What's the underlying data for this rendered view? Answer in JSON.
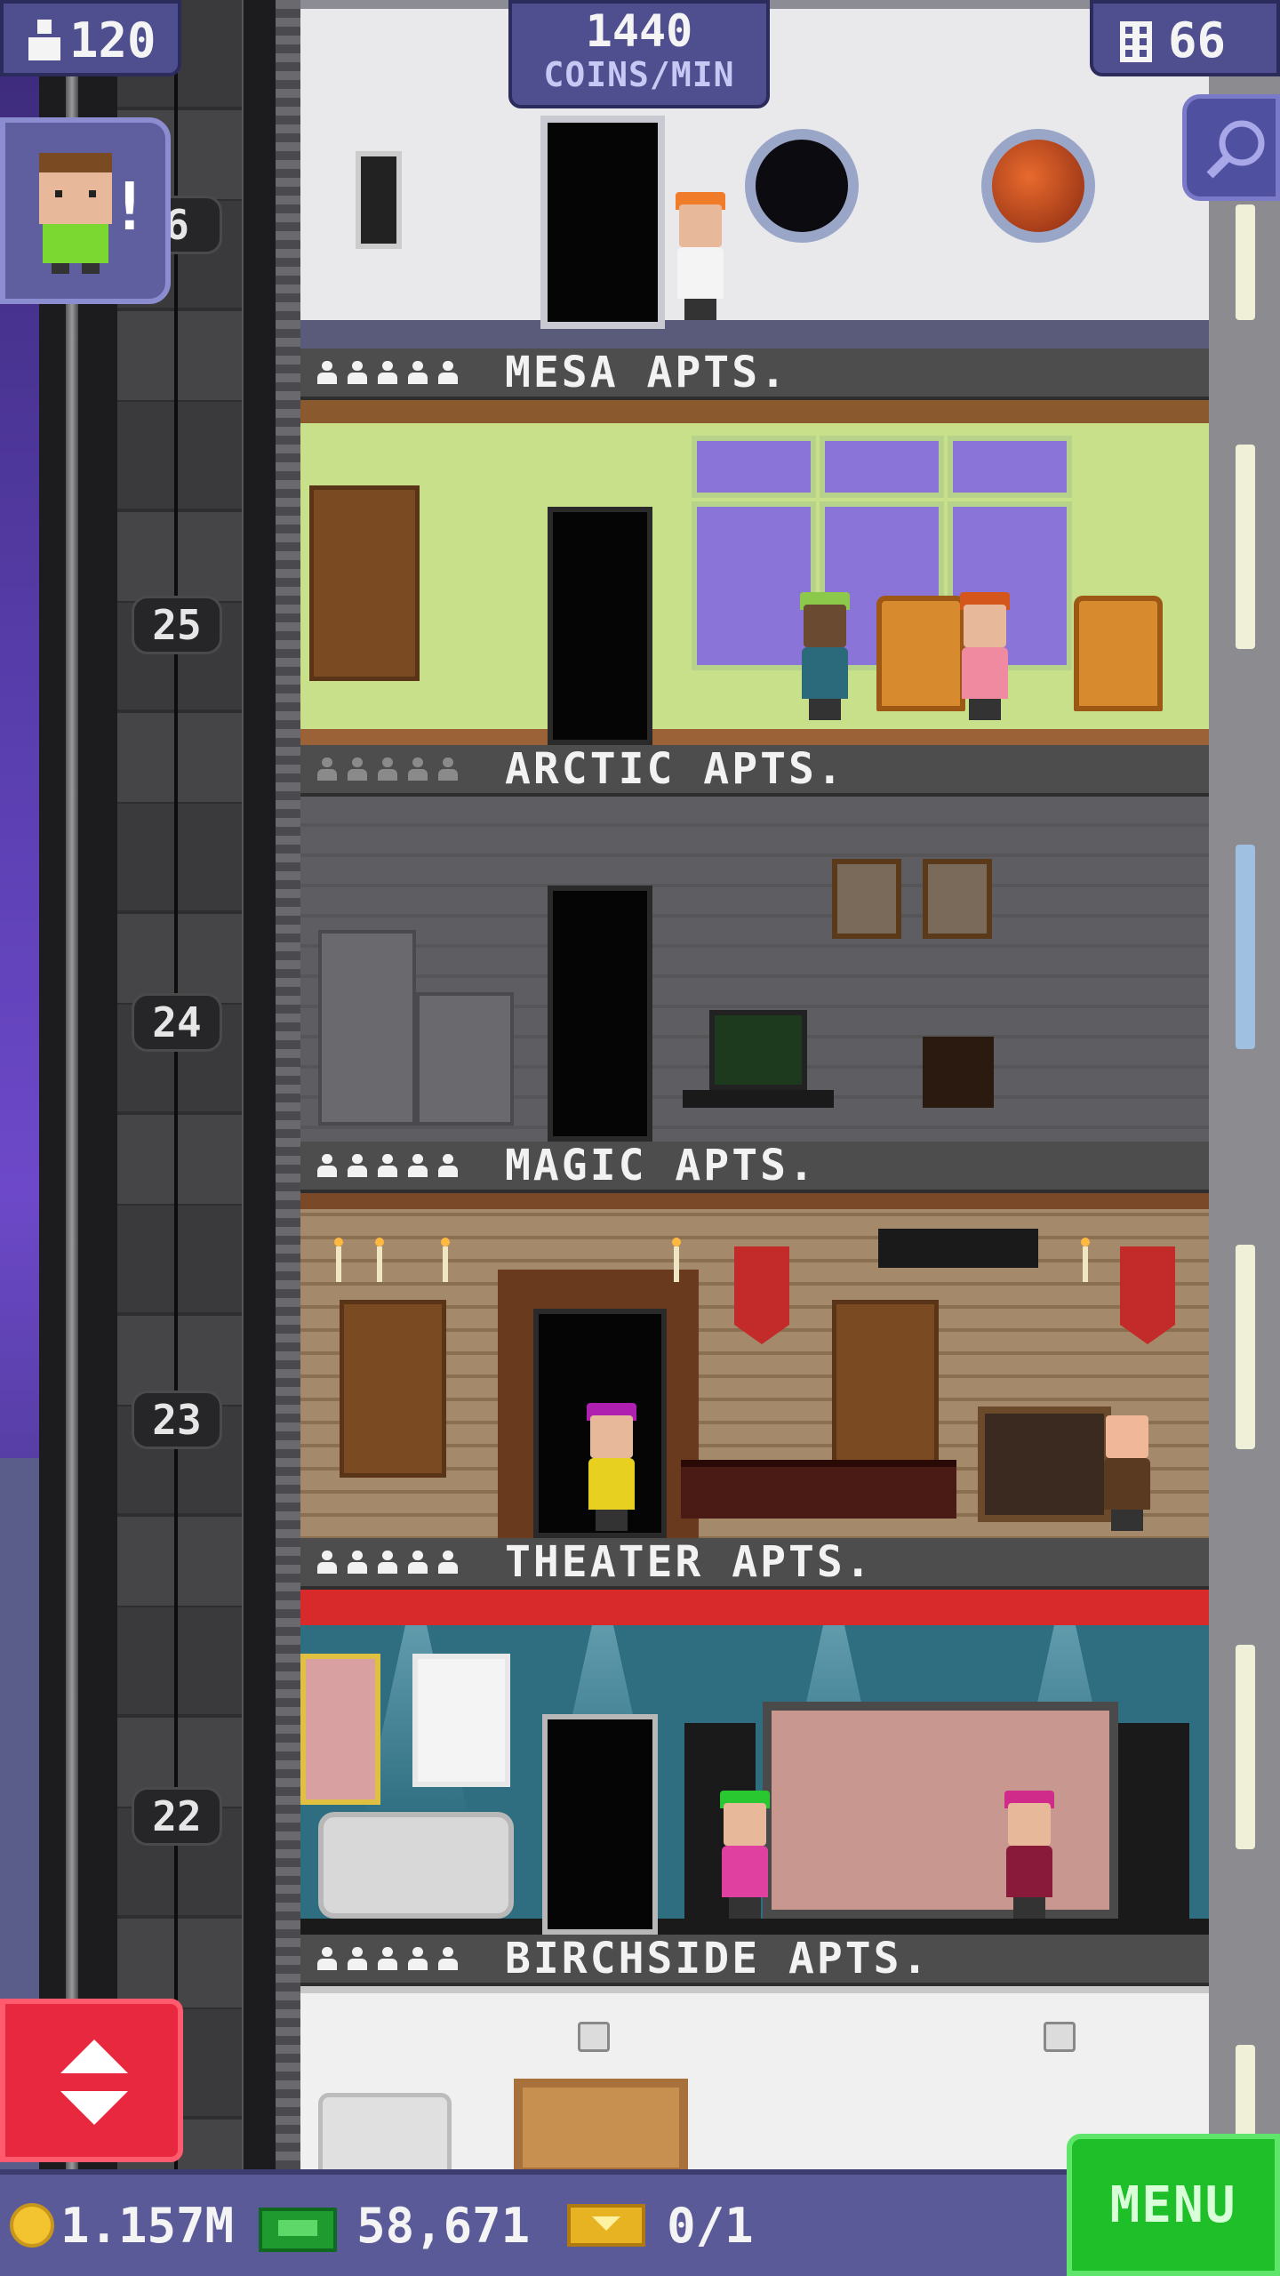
{
  "hud": {
    "population": "120",
    "income_value": "1440",
    "income_unit": "COINS/MIN",
    "floors_count": "66"
  },
  "elevator": {
    "floor_labels": [
      "6",
      "25",
      "24",
      "23",
      "22"
    ]
  },
  "floors": [
    {
      "name": "MESA APTS.",
      "theme": "mesa"
    },
    {
      "name": "ARCTIC APTS.",
      "theme": "arctic"
    },
    {
      "name": "MAGIC APTS.",
      "theme": "magic"
    },
    {
      "name": "THEATER APTS.",
      "theme": "theater"
    },
    {
      "name": "BIRCHSIDE APTS.",
      "theme": "birchside"
    }
  ],
  "bottom_bar": {
    "coins": "1.157M",
    "bux": "58,671",
    "tickets": "0/1",
    "menu_label": "MENU"
  },
  "colors": {
    "coin": "#f4c430",
    "bux": "#1f9a2f",
    "ticket": "#e7b322",
    "menu": "#1fbf2a",
    "elevator_button": "#e8283e"
  },
  "icons": [
    "person-icon",
    "building-icon",
    "search-icon",
    "exclamation-icon",
    "elevator-arrows-icon",
    "coin-icon",
    "bux-icon",
    "ticket-icon"
  ]
}
